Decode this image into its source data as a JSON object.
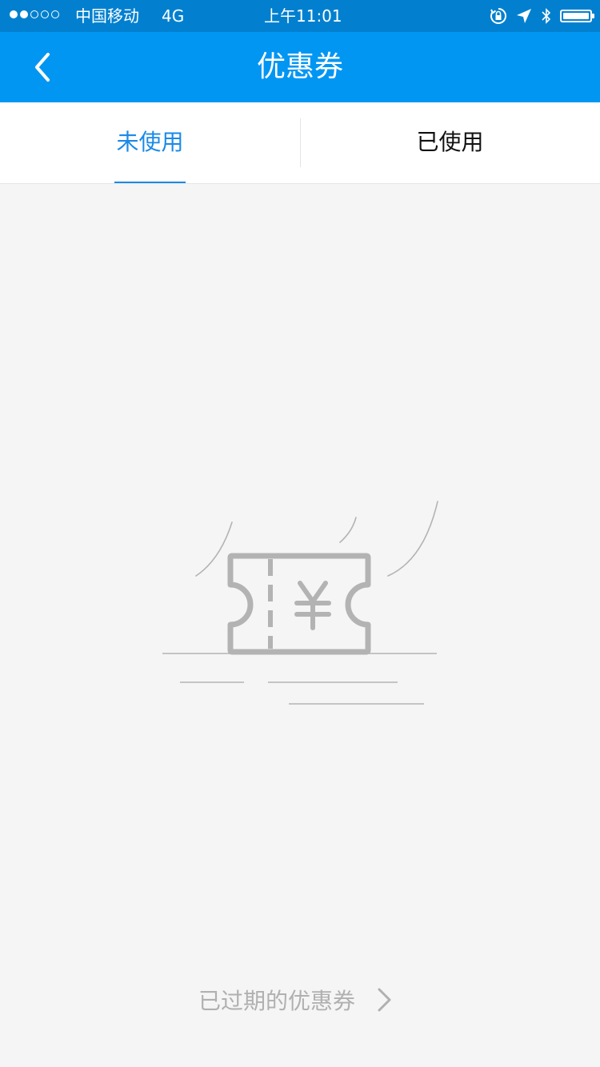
{
  "status_bar": {
    "carrier": "中国移动",
    "network": "4G",
    "time": "上午11:01",
    "signal_bars_filled": 2,
    "signal_bars_total": 5,
    "icons": [
      "rotation-lock-icon",
      "location-arrow-icon",
      "bluetooth-icon",
      "battery-icon"
    ],
    "battery_level": 1.0
  },
  "nav": {
    "title": "优惠券",
    "back_icon": "chevron-left-icon"
  },
  "tabs": [
    {
      "label": "未使用",
      "active": true
    },
    {
      "label": "已使用",
      "active": false
    }
  ],
  "empty_state": {
    "icon": "coupon-ticket-icon",
    "symbol": "¥"
  },
  "footer": {
    "expired_label": "已过期的优惠券",
    "chevron_icon": "chevron-right-icon"
  },
  "colors": {
    "status_bar_bg": "#0280cf",
    "nav_bg": "#0296f3",
    "accent": "#1a8ae8",
    "page_bg": "#f5f5f5",
    "illustration_gray": "#b3b3b3"
  }
}
